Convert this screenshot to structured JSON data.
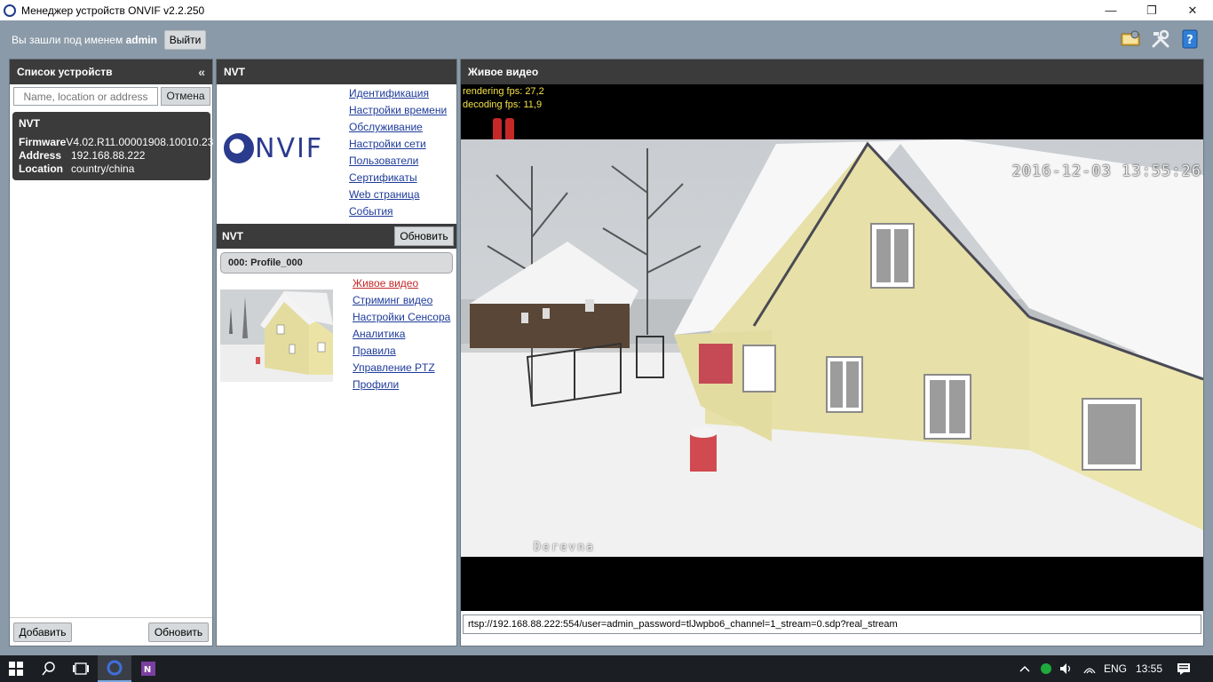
{
  "window": {
    "title": "Менеджер устройств ONVIF v2.2.250",
    "controls": {
      "minimize": "—",
      "maximize": "❐",
      "close": "✕"
    }
  },
  "header": {
    "logged_in_prefix": "Вы зашли под именем",
    "username": "admin",
    "logout_label": "Выйти",
    "icons": [
      "monitor-settings-icon",
      "tools-icon",
      "help-book-icon"
    ]
  },
  "device_list": {
    "title": "Список устройств",
    "search_placeholder": "Name, location or address",
    "cancel_label": "Отмена",
    "devices": [
      {
        "name": "NVT",
        "firmware_label": "Firmware",
        "firmware": "V4.02.R11.00001908.10010.23",
        "address_label": "Address",
        "address": "192.168.88.222",
        "location_label": "Location",
        "location": "country/china"
      }
    ],
    "add_label": "Добавить",
    "refresh_label": "Обновить"
  },
  "device_panel": {
    "title": "NVT",
    "logo_text": "NVIF",
    "menu": [
      "Идентификация",
      "Настройки времени",
      "Обслуживание",
      "Настройки сети",
      "Пользователи",
      "Сертификаты",
      "Web страница",
      "События"
    ],
    "nvt_title": "NVT",
    "refresh_label": "Обновить",
    "profile_name": "000: Profile_000",
    "profile_menu": [
      "Живое видео",
      "Стриминг видео",
      "Настройки Сенсора",
      "Аналитика",
      "Правила",
      "Управление PTZ",
      "Профили"
    ],
    "active_profile_item": "Живое видео"
  },
  "live_video": {
    "title": "Живое видео",
    "rendering_fps": "rendering fps: 27,2",
    "decoding_fps": "decoding fps: 11,9",
    "osd_timestamp": "2016-12-03  13:55:26",
    "osd_camera_name": "Derevna",
    "stream_url": "rtsp://192.168.88.222:554/user=admin_password=tlJwpbo6_channel=1_stream=0.sdp?real_stream"
  },
  "taskbar": {
    "language": "ENG",
    "time": "13:55",
    "icons": [
      "windows-start-icon",
      "search-icon",
      "task-view-icon",
      "onvif-app-icon",
      "onenote-icon",
      "chevron-up-icon",
      "status-dot-icon",
      "volume-icon",
      "wifi-icon",
      "notification-icon"
    ]
  },
  "colors": {
    "panel_header": "#3b3b3b",
    "link": "#1e3b9a",
    "active_link": "#c62828",
    "background": "#8b9aa8",
    "fps_text": "#f4e14a"
  }
}
